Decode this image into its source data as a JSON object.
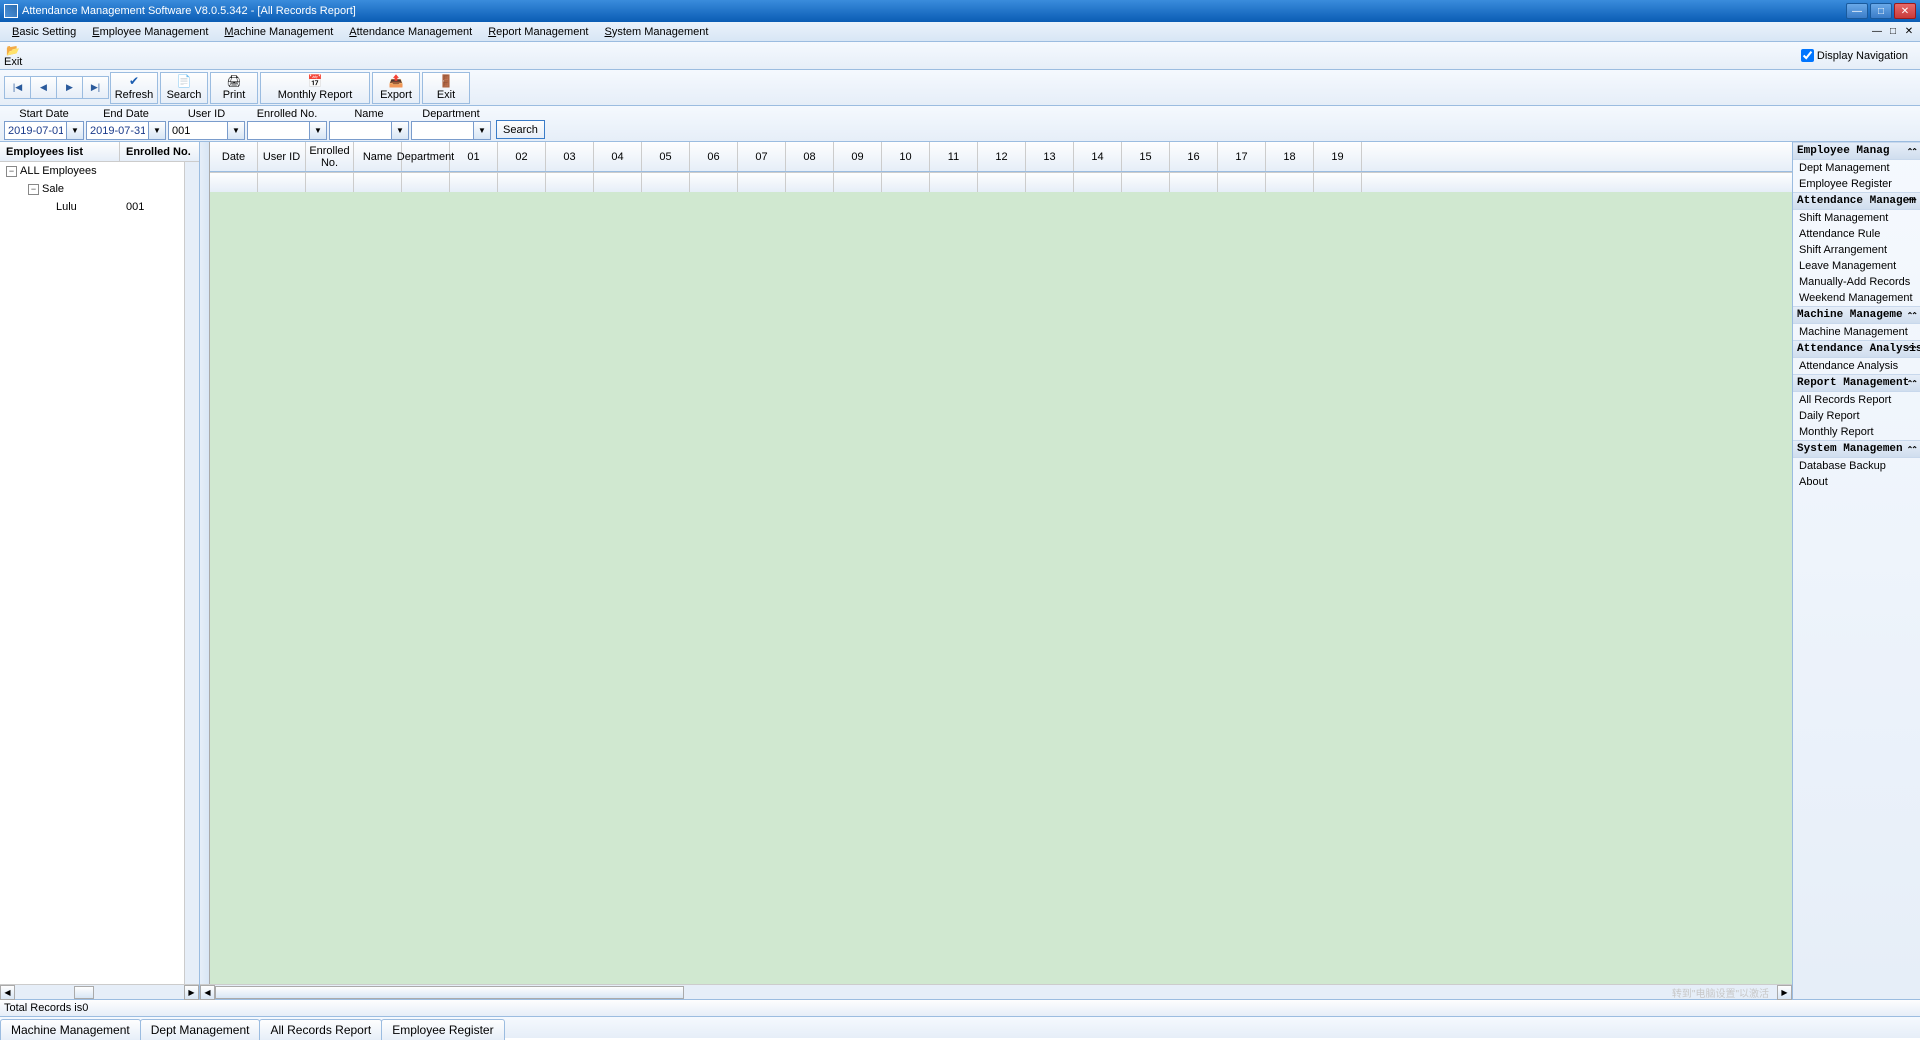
{
  "window": {
    "title": "Attendance Management Software V8.0.5.342 - [All Records Report]"
  },
  "menubar": {
    "items": [
      "Basic Setting",
      "Employee Management",
      "Machine Management",
      "Attendance Management",
      "Report Management",
      "System Management"
    ]
  },
  "exitbar": {
    "exit": "Exit",
    "display_nav": "Display Navigation"
  },
  "nav": {
    "first": "|◀",
    "prev": "◀",
    "next": "▶",
    "last": "▶|"
  },
  "toolbar": {
    "refresh": "Refresh",
    "search": "Search",
    "print": "Print",
    "monthly": "Monthly Report",
    "export": "Export",
    "exit": "Exit"
  },
  "filters": {
    "start_label": "Start Date",
    "start_val": "2019-07-01",
    "end_label": "End Date",
    "end_val": "2019-07-31",
    "userid_label": "User ID",
    "userid_val": "001",
    "enrolled_label": "Enrolled No.",
    "enrolled_val": "",
    "name_label": "Name",
    "name_val": "",
    "dept_label": "Department",
    "dept_val": "",
    "search_btn": "Search"
  },
  "tree": {
    "col1": "Employees list",
    "col2": "Enrolled No.",
    "root": "ALL Employees",
    "dept": "Sale",
    "emp_name": "Lulu",
    "emp_no": "001"
  },
  "grid": {
    "fixed_cols": [
      "Date",
      "User ID",
      "Enrolled No.",
      "Name",
      "Department"
    ],
    "day_cols": [
      "01",
      "02",
      "03",
      "04",
      "05",
      "06",
      "07",
      "08",
      "09",
      "10",
      "11",
      "12",
      "13",
      "14",
      "15",
      "16",
      "17",
      "18",
      "19"
    ],
    "fixed_widths": [
      48,
      48,
      48,
      48,
      48
    ],
    "day_width": 48
  },
  "right_nav": {
    "sections": [
      {
        "title": "Employee Manag",
        "items": [
          "Dept Management",
          "Employee Register"
        ]
      },
      {
        "title": "Attendance Managem",
        "items": [
          "Shift Management",
          "Attendance Rule",
          "Shift Arrangement",
          "Leave Management",
          "Manually-Add Records",
          "Weekend Management"
        ]
      },
      {
        "title": "Machine Manageme",
        "items": [
          "Machine Management"
        ]
      },
      {
        "title": "Attendance Analysis",
        "items": [
          "Attendance Analysis"
        ]
      },
      {
        "title": "Report Management",
        "items": [
          "All Records Report",
          "Daily Report",
          "Monthly Report"
        ]
      },
      {
        "title": "System Managemen",
        "items": [
          "Database Backup",
          "About"
        ]
      }
    ]
  },
  "status": {
    "text": "Total Records is0"
  },
  "bottom_tabs": [
    "Machine Management",
    "Dept Management",
    "All Records Report",
    "Employee Register"
  ],
  "watermark_hint": "转到\"电脑设置\"以激活"
}
